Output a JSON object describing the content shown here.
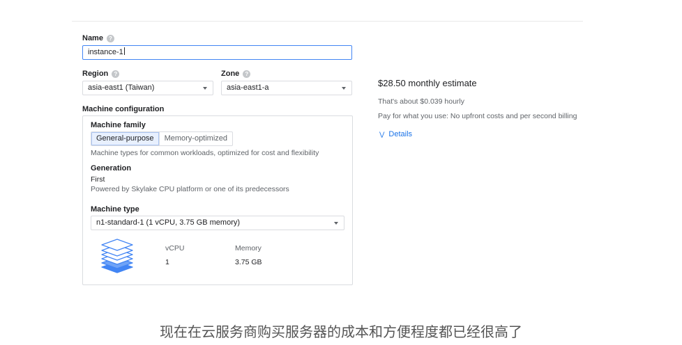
{
  "form": {
    "name_label": "Name",
    "name_value": "instance-1",
    "region_label": "Region",
    "region_value": "asia-east1 (Taiwan)",
    "zone_label": "Zone",
    "zone_value": "asia-east1-a",
    "machine_config_title": "Machine configuration"
  },
  "machine": {
    "family_label": "Machine family",
    "family_tabs": [
      "General-purpose",
      "Memory-optimized"
    ],
    "family_selected": "General-purpose",
    "family_description": "Machine types for common workloads, optimized for cost and flexibility",
    "generation_label": "Generation",
    "generation_value": "First",
    "generation_description": "Powered by Skylake CPU platform or one of its predecessors",
    "type_label": "Machine type",
    "type_value": "n1-standard-1 (1 vCPU, 3.75 GB memory)",
    "vcpu_header": "vCPU",
    "vcpu_value": "1",
    "memory_header": "Memory",
    "memory_value": "3.75 GB",
    "icon": "stack-layers-icon"
  },
  "estimate": {
    "title": "$28.50 monthly estimate",
    "hourly": "That's about $0.039 hourly",
    "billing": "Pay for what you use: No upfront costs and per second billing",
    "details_link": "Details"
  },
  "caption": "现在在云服务商购买服务器的成本和方便程度都已经很高了",
  "colors": {
    "accent": "#1a73e8",
    "focus_border": "#4285f4",
    "selected_tab_bg": "#e8f0fe",
    "icon_blue": "#4285f4"
  }
}
